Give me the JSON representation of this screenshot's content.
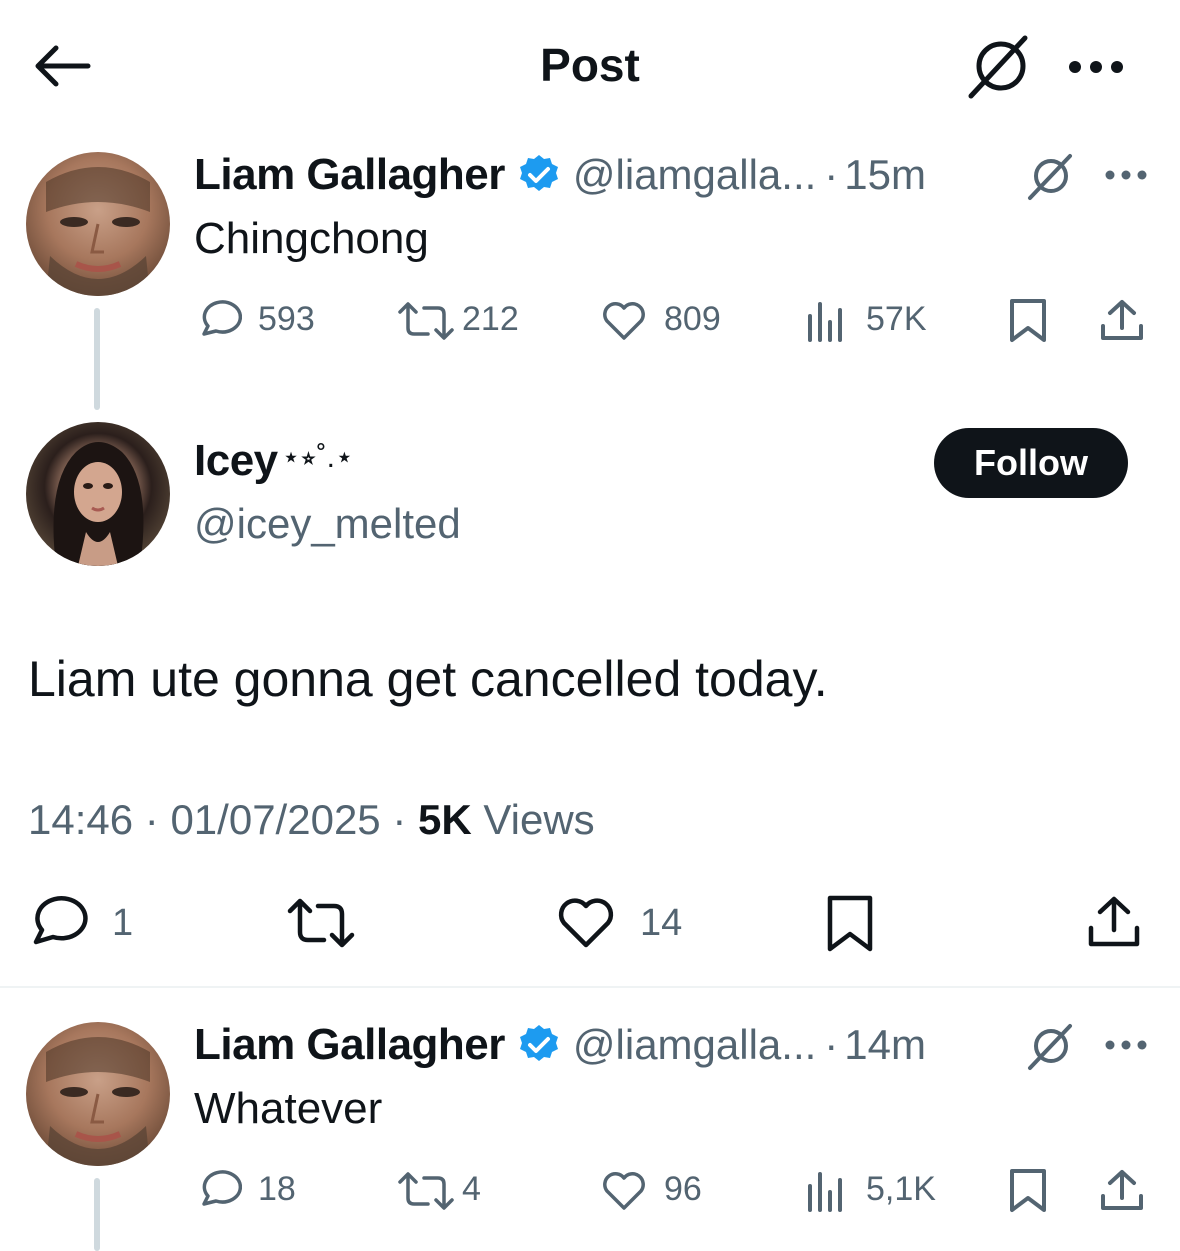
{
  "header": {
    "title": "Post"
  },
  "parent_tweet": {
    "name": "Liam Gallagher",
    "handle": "@liamgalla...",
    "dot": "·",
    "time": "15m",
    "text": "Chingchong",
    "replies": "593",
    "reposts": "212",
    "likes": "809",
    "views": "57K"
  },
  "main_tweet": {
    "name": "Icey",
    "name_decoration": "⋆⭒˚.⋆",
    "handle": "@icey_melted",
    "follow_label": "Follow",
    "text": "Liam ute gonna get cancelled today.",
    "time": "14:46",
    "date": "01/07/2025",
    "sep": "·",
    "views_count": "5K",
    "views_label": "Views",
    "replies": "1",
    "likes": "14"
  },
  "reply_tweet": {
    "name": "Liam Gallagher",
    "handle": "@liamgalla...",
    "dot": "·",
    "time": "14m",
    "text": "Whatever",
    "replies": "18",
    "reposts": "4",
    "likes": "96",
    "views": "5,1K"
  },
  "colors": {
    "verified": "#1d9bf0",
    "muted": "#536471",
    "text": "#0f1419"
  }
}
